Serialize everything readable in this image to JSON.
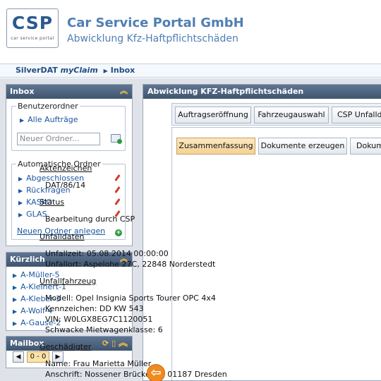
{
  "header": {
    "logo_text": "CSP",
    "logo_subtext": "car service portal",
    "company": "Car Service Portal GmbH",
    "subtitle": "Abwicklung Kfz-Haftpflichtschäden"
  },
  "breadcrumb": {
    "part1": "SilverDAT",
    "part2": "myClaim",
    "part3": "Inbox"
  },
  "inbox": {
    "title": "Inbox",
    "user_folders_legend": "Benutzerordner",
    "all_orders": "Alle Aufträge",
    "new_folder_placeholder": "Neuer Ordner...",
    "auto_folders_legend": "Automatische Ordner",
    "auto_folders": [
      "Abgeschlossen",
      "Rückfragen",
      "KASKO",
      "GLAS"
    ],
    "create_folder_link": "Neuen Ordner anlegen"
  },
  "recent": {
    "title": "Kürzlich",
    "items": [
      "A-Müller-5",
      "A-Kleinert-1",
      "A-Kleber-3",
      "A-Wolf-4",
      "A-Gause-2"
    ]
  },
  "mailbox": {
    "title": "Mailbox",
    "counter": "0 - 0"
  },
  "main": {
    "title": "Abwicklung KFZ-Haftpflichtschäden",
    "top_tabs": [
      "Auftragseröffnung",
      "Fahrzeugauswahl",
      "CSP Unfalldo"
    ],
    "sub_tabs": [
      "Zusammenfassung",
      "Dokumente erzeugen",
      "Dokum"
    ],
    "sections": {
      "aktenzeichen_title": "Aktenzeichen",
      "aktenzeichen_value": "DAT/86/14",
      "status_title": "Status",
      "status_value": "Bearbeitung durch CSP",
      "unfalldaten_title": "Unfalldaten",
      "unfallzeit": "Unfallzeit: 05.08.2014 00:00:00",
      "unfallort": "Unfallort: Aspelohe 27C, 22848 Norderstedt",
      "unfallfahrzeug_title": "Unfallfahrzeug",
      "modell": "Modell: Opel Insignia Sports Tourer OPC 4x4",
      "kennzeichen": "Kennzeichen: DD KW 543",
      "vin": "VIN: W0LGX8EG7C1120051",
      "mietwagen": "Schwacke Mietwagenklasse: 6",
      "geschaedigter_title": "Geschädigter",
      "name": "Name: Frau Marietta Müller",
      "anschrift": "Anschrift: Nossener Brücke 10, 01187 Dresden"
    }
  }
}
